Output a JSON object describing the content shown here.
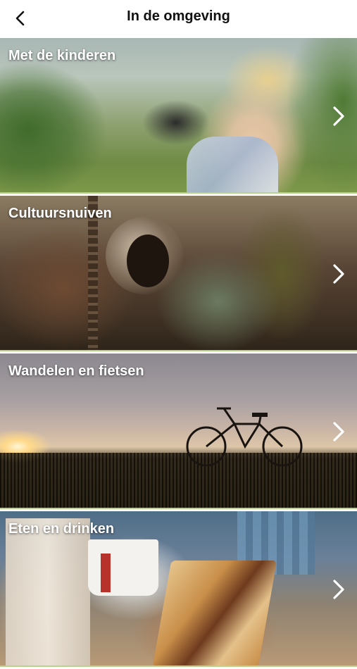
{
  "header": {
    "title": "In de omgeving",
    "back_icon": "chevron-left-icon"
  },
  "tiles": [
    {
      "label": "Met de kinderen",
      "icon": "chevron-right-icon"
    },
    {
      "label": "Cultuursnuiven",
      "icon": "chevron-right-icon"
    },
    {
      "label": "Wandelen en fietsen",
      "icon": "chevron-right-icon"
    },
    {
      "label": "Eten en drinken",
      "icon": "chevron-right-icon"
    }
  ],
  "colors": {
    "header_bg": "#ffffff",
    "title_text": "#111111",
    "tile_label_text": "#ffffff",
    "tile_separator": "#b7d38f"
  }
}
